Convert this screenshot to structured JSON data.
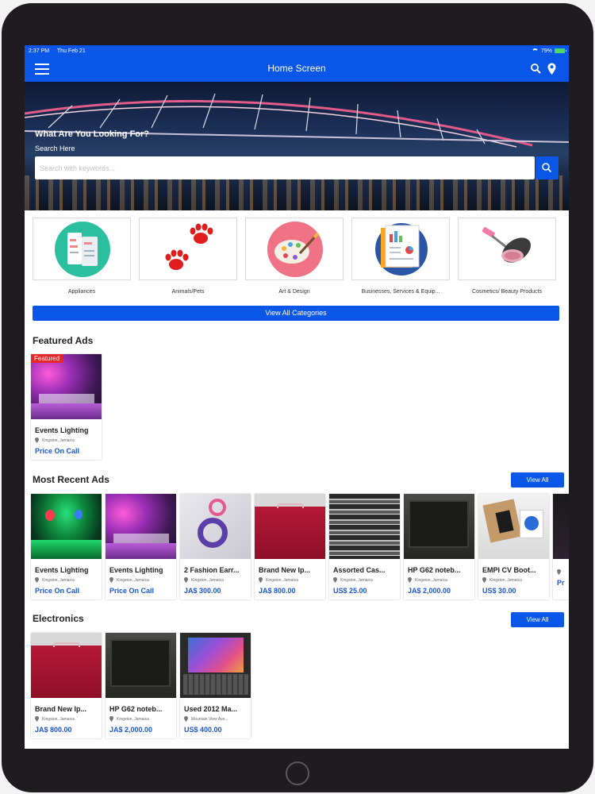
{
  "status_bar": {
    "time": "2:37 PM",
    "date": "Thu Feb 21",
    "battery": "79%"
  },
  "nav": {
    "title": "Home Screen"
  },
  "hero": {
    "question": "What Are You Looking For?",
    "subtitle": "Search Here",
    "search_placeholder": "Search with keywords..."
  },
  "categories": {
    "items": [
      {
        "label": "Appliances",
        "icon": "appliances-icon"
      },
      {
        "label": "Animals/Pets",
        "icon": "paw-prints-icon"
      },
      {
        "label": "Art & Design",
        "icon": "palette-icon"
      },
      {
        "label": "Businesses, Services & Equip...",
        "icon": "business-report-icon"
      },
      {
        "label": "Cosmetics/ Beauty Products",
        "icon": "cosmetics-icon"
      }
    ],
    "view_all_label": "View All Categories"
  },
  "featured": {
    "title": "Featured Ads",
    "ads": [
      {
        "badge": "Featured",
        "title": "Events Lighting",
        "location": "Kingston, Jamaica",
        "price": "Price On Call"
      }
    ]
  },
  "recent": {
    "title": "Most Recent Ads",
    "view_all": "View All",
    "ads": [
      {
        "title": "Events Lighting",
        "location": "Kingston, Jamaica",
        "price": "Price On Call"
      },
      {
        "title": "Events Lighting",
        "location": "Kingston, Jamaica",
        "price": "Price On Call"
      },
      {
        "title": "2 Fashion Earr...",
        "location": "Kingston, Jamaica",
        "price": "JA$ 300.00"
      },
      {
        "title": "Brand New Ip...",
        "location": "Kingston, Jamaica",
        "price": "JA$ 800.00"
      },
      {
        "title": "Assorted Cas...",
        "location": "Kingston, Jamaica",
        "price": "US$ 25.00"
      },
      {
        "title": "HP G62 noteb...",
        "location": "Kingston, Jamaica",
        "price": "JA$ 2,000.00"
      },
      {
        "title": "EMPI CV Boot...",
        "location": "Kingston, Jamaica",
        "price": "US$ 30.00"
      },
      {
        "title": "",
        "location": "",
        "price": "Pr"
      }
    ]
  },
  "electronics": {
    "title": "Electronics",
    "view_all": "View All",
    "ads": [
      {
        "title": "Brand New Ip...",
        "location": "Kingston, Jamaica",
        "price": "JA$ 800.00"
      },
      {
        "title": "HP G62 noteb...",
        "location": "Kingston, Jamaica",
        "price": "JA$ 2,000.00"
      },
      {
        "title": "Used 2012 Ma...",
        "location": "Mountain View Ave...",
        "price": "US$ 400.00"
      }
    ]
  },
  "colors": {
    "accent": "#0a56e8",
    "price": "#1a56d8",
    "badge": "#e8272b"
  }
}
